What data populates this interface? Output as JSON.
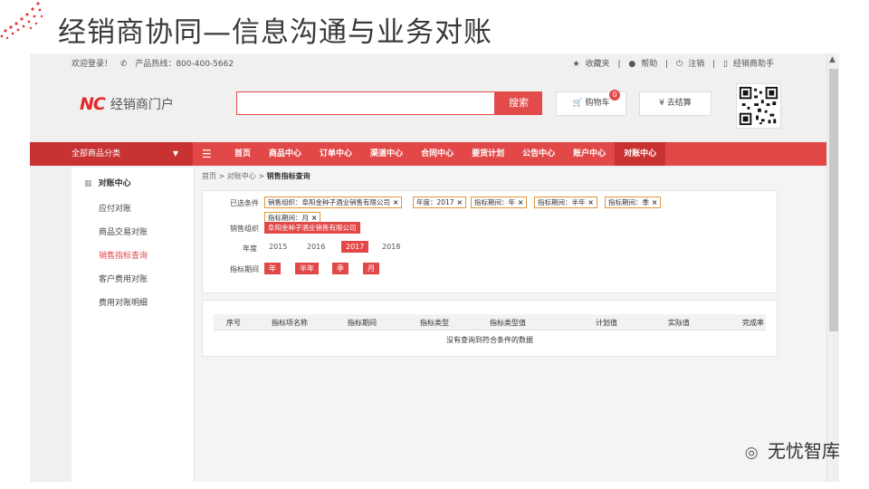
{
  "slide": {
    "title": "经销商协同—信息沟通与业务对账"
  },
  "topbar": {
    "welcome": "欢迎登录！",
    "hotline": "产品热线：800-400-5662",
    "favorites": "收藏夹",
    "help": "帮助",
    "logout": "注销",
    "assistant": "经销商助手"
  },
  "header": {
    "logo_mark": "NC",
    "logo_text": "经销商门户",
    "search_placeholder": "",
    "search_btn": "搜索",
    "cart": "购物车",
    "cart_count": "0",
    "checkout": "去结算"
  },
  "nav": {
    "category": "全部商品分类",
    "items": [
      "首页",
      "商品中心",
      "订单中心",
      "渠道中心",
      "合同中心",
      "要货计划",
      "公告中心",
      "账户中心",
      "对账中心"
    ],
    "active_index": 8
  },
  "sidebar": {
    "head": "对账中心",
    "items": [
      "应付对账",
      "商品交易对账",
      "销售指标查询",
      "客户费用对账",
      "费用对账明细"
    ],
    "active_index": 2
  },
  "breadcrumb": {
    "home": "首页",
    "sep": ">",
    "level1": "对账中心",
    "current": "销售指标查询"
  },
  "filter": {
    "selected_label": "已选条件",
    "selected_tags": [
      "销售组织：阜阳金种子酒业销售有限公司",
      "年度：2017",
      "指标期间：年",
      "指标期间：半年",
      "指标期间：季",
      "指标期间：月"
    ],
    "org_label": "销售组织",
    "org_value": "阜阳金种子酒业销售有限公司",
    "year_label": "年度",
    "years": [
      "2015",
      "2016",
      "2017",
      "2018"
    ],
    "selected_year": "2017",
    "period_label": "指标期间",
    "periods": [
      "年",
      "半年",
      "季",
      "月"
    ]
  },
  "table": {
    "columns": [
      "序号",
      "指标项名称",
      "指标期间",
      "指标类型",
      "指标类型值",
      "计划值",
      "实际值",
      "完成率"
    ],
    "empty_message": "没有查询到符合条件的数据"
  },
  "watermark": {
    "text": "无忧智库"
  }
}
